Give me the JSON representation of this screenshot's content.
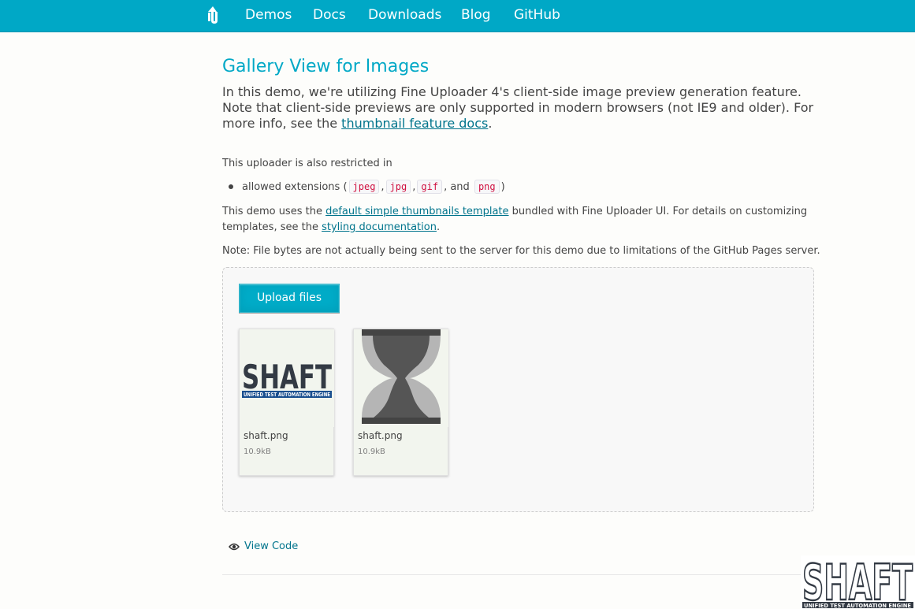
{
  "nav": {
    "logo_icon": "fine-uploader-logo",
    "links": [
      "Demos",
      "Docs",
      "Downloads",
      "Blog",
      "GitHub"
    ]
  },
  "page": {
    "title": "Gallery View for Images",
    "lead_text": "In this demo, we're utilizing Fine Uploader 4's client-side image preview generation feature. Note that client-side previews are only supported in modern browsers (not IE9 and older). For more info, see the ",
    "lead_link": "thumbnail feature docs",
    "lead_end": ".",
    "restricted_intro": "This uploader is also restricted in",
    "allowed_label": "allowed extensions (",
    "extensions": [
      "jpeg",
      "jpg",
      "gif",
      "png"
    ],
    "sep1": ",",
    "sep2": ",",
    "sep3": ", and",
    "allowed_end": ")",
    "template_text_1": "This demo uses the ",
    "template_link": "default simple thumbnails template",
    "template_text_2": " bundled with Fine Uploader UI. For details on customizing templates, see the ",
    "styling_link": "styling documentation",
    "template_end": ".",
    "note": "Note: File bytes are not actually being sent to the server for this demo due to limitations of the GitHub Pages server."
  },
  "uploader": {
    "button_label": "Upload files",
    "files": [
      {
        "name": "shaft.png",
        "size": "10.9kB",
        "thumbnail": "shaft-logo"
      },
      {
        "name": "shaft.png",
        "size": "10.9kB",
        "thumbnail": "hourglass"
      }
    ]
  },
  "footer": {
    "view_code": "View Code",
    "view_code_icon": "eye-icon"
  },
  "watermark": {
    "text": "SHAFT",
    "subtext": "UNIFIED TEST AUTOMATION ENGINE"
  },
  "colors": {
    "accent": "#00a8c6",
    "link": "#00748c"
  }
}
